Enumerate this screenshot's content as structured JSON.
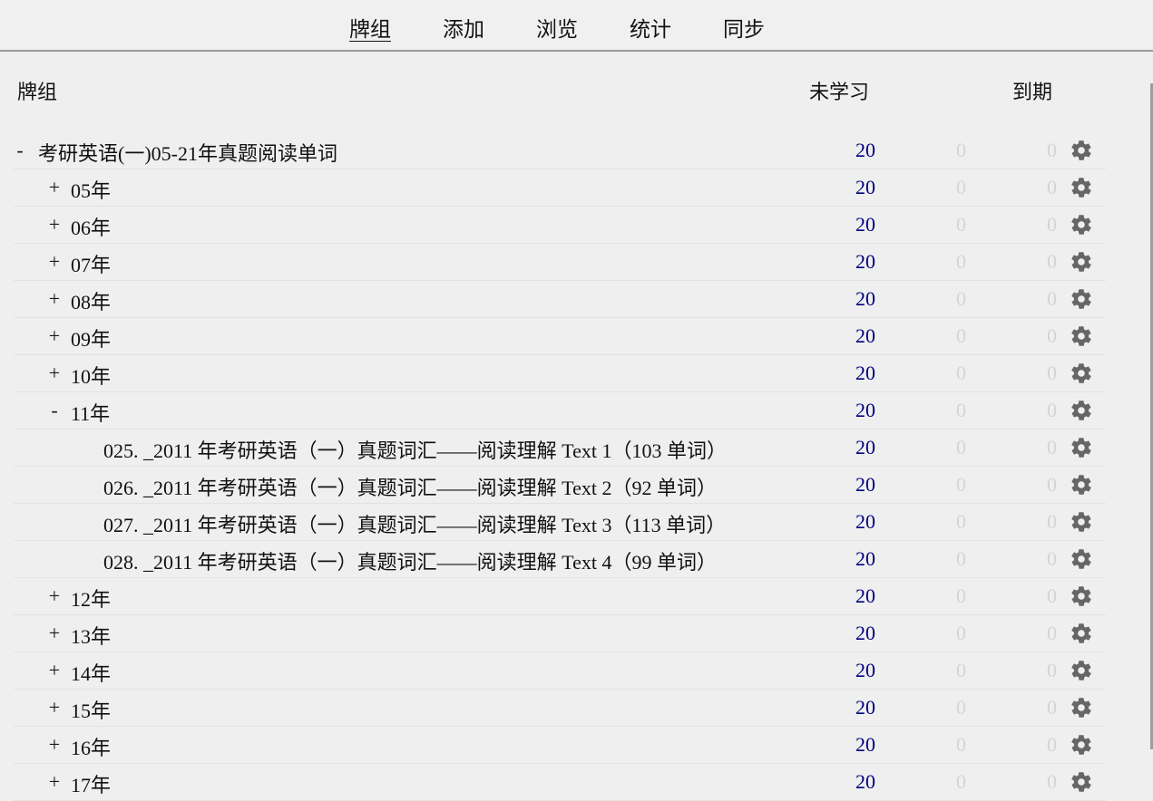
{
  "nav": {
    "items": [
      {
        "label": "牌组",
        "active": true
      },
      {
        "label": "添加",
        "active": false
      },
      {
        "label": "浏览",
        "active": false
      },
      {
        "label": "统计",
        "active": false
      },
      {
        "label": "同步",
        "active": false
      }
    ]
  },
  "table": {
    "headers": {
      "deck": "牌组",
      "new": "未学习",
      "due": "到期"
    },
    "rows": [
      {
        "level": 0,
        "toggle": "-",
        "name": "考研英语(一)05-21年真题阅读单词",
        "new": "20",
        "learn": "0",
        "due": "0"
      },
      {
        "level": 1,
        "toggle": "+",
        "name": "05年",
        "new": "20",
        "learn": "0",
        "due": "0"
      },
      {
        "level": 1,
        "toggle": "+",
        "name": "06年",
        "new": "20",
        "learn": "0",
        "due": "0"
      },
      {
        "level": 1,
        "toggle": "+",
        "name": "07年",
        "new": "20",
        "learn": "0",
        "due": "0"
      },
      {
        "level": 1,
        "toggle": "+",
        "name": "08年",
        "new": "20",
        "learn": "0",
        "due": "0"
      },
      {
        "level": 1,
        "toggle": "+",
        "name": "09年",
        "new": "20",
        "learn": "0",
        "due": "0"
      },
      {
        "level": 1,
        "toggle": "+",
        "name": "10年",
        "new": "20",
        "learn": "0",
        "due": "0"
      },
      {
        "level": 1,
        "toggle": "-",
        "name": "11年",
        "new": "20",
        "learn": "0",
        "due": "0"
      },
      {
        "level": 2,
        "toggle": "",
        "name": "025. _2011 年考研英语（一）真题词汇——阅读理解 Text 1（103 单词）",
        "new": "20",
        "learn": "0",
        "due": "0"
      },
      {
        "level": 2,
        "toggle": "",
        "name": "026. _2011 年考研英语（一）真题词汇——阅读理解 Text 2（92 单词）",
        "new": "20",
        "learn": "0",
        "due": "0"
      },
      {
        "level": 2,
        "toggle": "",
        "name": "027. _2011 年考研英语（一）真题词汇——阅读理解 Text 3（113 单词）",
        "new": "20",
        "learn": "0",
        "due": "0"
      },
      {
        "level": 2,
        "toggle": "",
        "name": "028. _2011 年考研英语（一）真题词汇——阅读理解 Text 4（99 单词）",
        "new": "20",
        "learn": "0",
        "due": "0"
      },
      {
        "level": 1,
        "toggle": "+",
        "name": "12年",
        "new": "20",
        "learn": "0",
        "due": "0"
      },
      {
        "level": 1,
        "toggle": "+",
        "name": "13年",
        "new": "20",
        "learn": "0",
        "due": "0"
      },
      {
        "level": 1,
        "toggle": "+",
        "name": "14年",
        "new": "20",
        "learn": "0",
        "due": "0"
      },
      {
        "level": 1,
        "toggle": "+",
        "name": "15年",
        "new": "20",
        "learn": "0",
        "due": "0"
      },
      {
        "level": 1,
        "toggle": "+",
        "name": "16年",
        "new": "20",
        "learn": "0",
        "due": "0"
      },
      {
        "level": 1,
        "toggle": "+",
        "name": "17年",
        "new": "20",
        "learn": "0",
        "due": "0"
      }
    ]
  },
  "icons": {
    "options": "gear-icon"
  },
  "colors": {
    "new_count": "#000080",
    "zero_count": "#d4d4d4",
    "gear": "#666666"
  }
}
